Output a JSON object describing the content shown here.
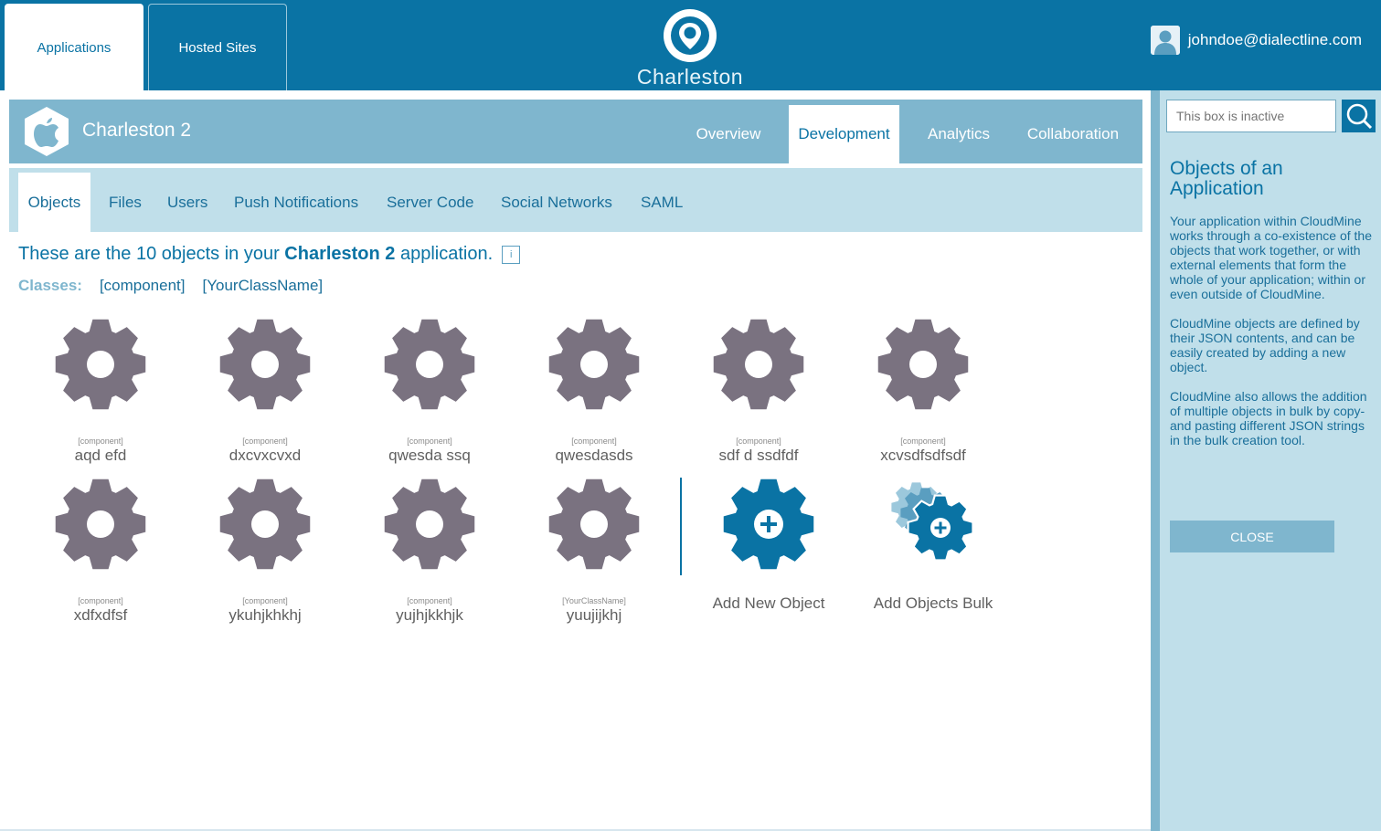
{
  "topbar": {
    "tabs": [
      {
        "label": "Applications",
        "active": true
      },
      {
        "label": "Hosted Sites",
        "active": false
      }
    ],
    "brand": "Charleston",
    "user_email": "johndoe@dialectline.com"
  },
  "app": {
    "name": "Charleston 2",
    "tabs": [
      {
        "label": "Overview",
        "active": false
      },
      {
        "label": "Development",
        "active": true
      },
      {
        "label": "Analytics",
        "active": false
      },
      {
        "label": "Collaboration",
        "active": false
      }
    ]
  },
  "subnav": {
    "tabs": [
      {
        "label": "Objects",
        "active": true
      },
      {
        "label": "Files",
        "active": false
      },
      {
        "label": "Users",
        "active": false
      },
      {
        "label": "Push Notifications",
        "active": false
      },
      {
        "label": "Server Code",
        "active": false
      },
      {
        "label": "Social Networks",
        "active": false
      },
      {
        "label": "SAML",
        "active": false
      }
    ]
  },
  "content": {
    "intro_prefix": "These are the 10 objects in your ",
    "intro_app": "Charleston 2",
    "intro_suffix": " application.",
    "info_glyph": "i",
    "classes_label": "Classes:",
    "classes": [
      "[component]",
      "[YourClassName]"
    ],
    "objects": [
      {
        "class": "[component]",
        "name": "aqd efd"
      },
      {
        "class": "[component]",
        "name": "dxcvxcvxd"
      },
      {
        "class": "[component]",
        "name": "qwesda ssq"
      },
      {
        "class": "[component]",
        "name": "qwesdasds"
      },
      {
        "class": "[component]",
        "name": "sdf d ssdfdf"
      },
      {
        "class": "[component]",
        "name": "xcvsdfsdfsdf"
      },
      {
        "class": "[component]",
        "name": "xdfxdfsf"
      },
      {
        "class": "[component]",
        "name": "ykuhjkhkhj"
      },
      {
        "class": "[component]",
        "name": "yujhjkkhjk"
      },
      {
        "class": "[YourClassName]",
        "name": "yuujijkhj"
      }
    ],
    "actions": {
      "add_new": "Add New Object",
      "add_bulk": "Add Objects Bulk"
    }
  },
  "help": {
    "search_placeholder": "This box is inactive",
    "title": "Objects of an Application",
    "paragraphs": [
      "Your application within CloudMine works through a co-existence of the objects that work together, or with external elements that form the whole of your application; within or even outside of CloudMine.",
      "CloudMine objects are defined by their JSON contents, and can be easily created by adding a new object.",
      "CloudMine also allows the addition of multiple objects in bulk by copy- and pasting different JSON strings in the bulk creation tool."
    ],
    "close_label": "CLOSE"
  },
  "colors": {
    "brand": "#0a73a4",
    "band": "#7fb6ce",
    "light_band": "#c0dfea",
    "gear": "#7a7280"
  }
}
